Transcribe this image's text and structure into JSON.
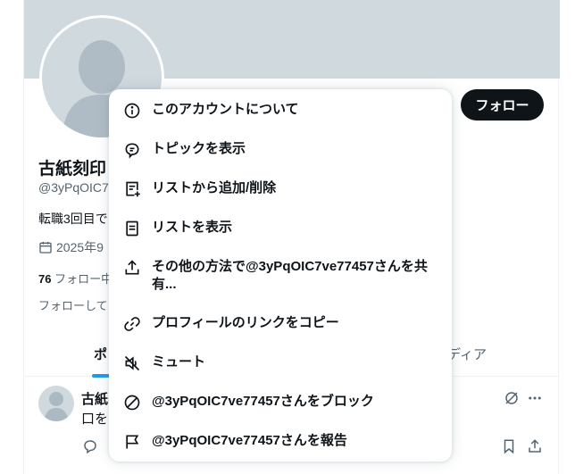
{
  "profile": {
    "display_name": "古紙刻印",
    "handle": "@3yPqOIC7",
    "bio": "転職3回目で",
    "joined": "2025年9",
    "stats_count": "76",
    "stats_label": "フォロー中",
    "followed_by": "フォローして"
  },
  "header": {
    "follow_label": "フォロー"
  },
  "tabs": {
    "posts": "ポ",
    "media": "ディア"
  },
  "tweet": {
    "name": "古紙",
    "text": "口を"
  },
  "menu": {
    "items": [
      {
        "label": "このアカウントについて",
        "icon": "info-icon"
      },
      {
        "label": "トピックを表示",
        "icon": "topic-icon"
      },
      {
        "label": "リストから追加/削除",
        "icon": "list-add-icon"
      },
      {
        "label": "リストを表示",
        "icon": "list-icon"
      },
      {
        "label": "その他の方法で@3yPqOIC7ve77457さんを共有...",
        "icon": "share-icon"
      },
      {
        "label": "プロフィールのリンクをコピー",
        "icon": "link-icon"
      },
      {
        "label": "ミュート",
        "icon": "mute-icon"
      },
      {
        "label": "@3yPqOIC7ve77457さんをブロック",
        "icon": "block-icon"
      },
      {
        "label": "@3yPqOIC7ve77457さんを報告",
        "icon": "flag-icon"
      }
    ]
  },
  "colors": {
    "banner": "#cfd9de",
    "accent": "#1d9bf0",
    "text": "#0f1419",
    "muted": "#536471"
  }
}
